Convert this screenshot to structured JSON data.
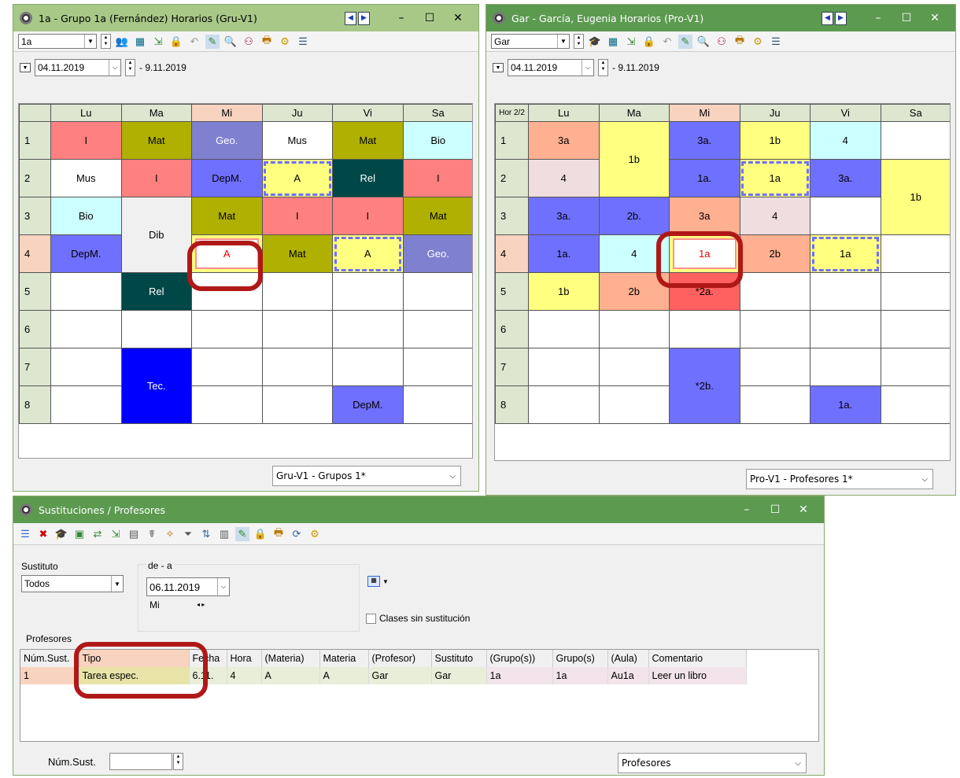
{
  "group_window": {
    "title": "1a - Grupo 1a (Fernández)  Horarios  (Gru-V1)",
    "selector": "1a",
    "date_from": "04.11.2019",
    "date_to": "- 9.11.2019",
    "days": [
      "Lu",
      "Ma",
      "Mi",
      "Ju",
      "Vi",
      "Sa"
    ],
    "hours": [
      "1",
      "2",
      "3",
      "4",
      "5",
      "6",
      "7",
      "8"
    ],
    "view": "Gru-V1 - Grupos 1*",
    "cells": {
      "r1": [
        "I",
        "Mat",
        "Geo.",
        "Mus",
        "Mat",
        "Bio"
      ],
      "r2": [
        "Mus",
        "I",
        "DepM.",
        "A",
        "Rel",
        "I"
      ],
      "r3": [
        "Bio",
        "Dib",
        "Mat",
        "I",
        "I",
        "Mat"
      ],
      "r4": [
        "DepM.",
        "A",
        "Mat",
        "A",
        "Geo."
      ],
      "r5": [
        "Rel"
      ],
      "r7": [
        "Tec."
      ],
      "r8": [
        "DepM."
      ]
    }
  },
  "teacher_window": {
    "title": "Gar - García, Eugenia  Horarios  (Pro-V1)",
    "selector": "Gar",
    "date_from": "04.11.2019",
    "date_to": "- 9.11.2019",
    "corner": "Hor 2/2",
    "days": [
      "Lu",
      "Ma",
      "Mi",
      "Ju",
      "Vi",
      "Sa"
    ],
    "hours": [
      "1",
      "2",
      "3",
      "4",
      "5",
      "6",
      "7",
      "8"
    ],
    "view": "Pro-V1 - Profesores 1*",
    "cells": {
      "r1": [
        "3a",
        "1b",
        "3a.",
        "1b",
        "4"
      ],
      "r2": [
        "4",
        "1a.",
        "1a",
        "3a.",
        "1b"
      ],
      "r3": [
        "3a.",
        "2b.",
        "3a",
        "4"
      ],
      "r4": [
        "1a.",
        "4",
        "1a",
        "2b",
        "1a"
      ],
      "r5": [
        "1b",
        "2b",
        "*2a."
      ],
      "r7": [
        "*2b."
      ],
      "r8": [
        "1a."
      ]
    }
  },
  "subs_window": {
    "title": "Sustituciones / Profesores",
    "sustituto_label": "Sustituto",
    "sustituto_value": "Todos",
    "range_label": "de - a",
    "date": "06.11.2019",
    "weekday": "Mi",
    "nav": "◂  ▸",
    "checkbox_label": "Clases sin sustitución",
    "section_label": "Profesores",
    "columns": [
      "Núm.Sust.",
      "Tipo",
      "Fecha",
      "Hora",
      "(Materia)",
      "Materia",
      "(Profesor)",
      "Sustituto",
      "(Grupo(s))",
      "Grupo(s)",
      "(Aula)",
      "Comentario"
    ],
    "rows": [
      [
        "1",
        "Tarea espec.",
        "6.11.",
        "4",
        "A",
        "A",
        "Gar",
        "Gar",
        "1a",
        "1a",
        "Au1a",
        "Leer un libro"
      ]
    ],
    "num_label": "Núm.Sust.",
    "view": "Profesores"
  }
}
